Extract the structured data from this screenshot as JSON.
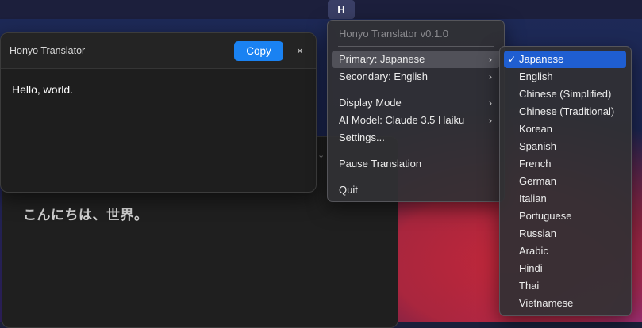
{
  "menubar": {
    "app_icon_label": "H"
  },
  "background_window": {
    "translation_text": "こんにちは、世界。",
    "collapse_glyph": "⌄"
  },
  "popup": {
    "title": "Honyo Translator",
    "copy_label": "Copy",
    "close_label": "×",
    "body_text": "Hello, world."
  },
  "menu": {
    "version": "Honyo Translator v0.1.0",
    "primary": "Primary: Japanese",
    "secondary": "Secondary: English",
    "display_mode": "Display Mode",
    "ai_model": "AI Model: Claude 3.5 Haiku",
    "settings": "Settings...",
    "pause": "Pause Translation",
    "quit": "Quit",
    "arrow": "›"
  },
  "languages": {
    "checkmark": "✓",
    "items": [
      "Japanese",
      "English",
      "Chinese (Simplified)",
      "Chinese (Traditional)",
      "Korean",
      "Spanish",
      "French",
      "German",
      "Italian",
      "Portuguese",
      "Russian",
      "Arabic",
      "Hindi",
      "Thai",
      "Vietnamese"
    ],
    "selected": "Japanese"
  }
}
